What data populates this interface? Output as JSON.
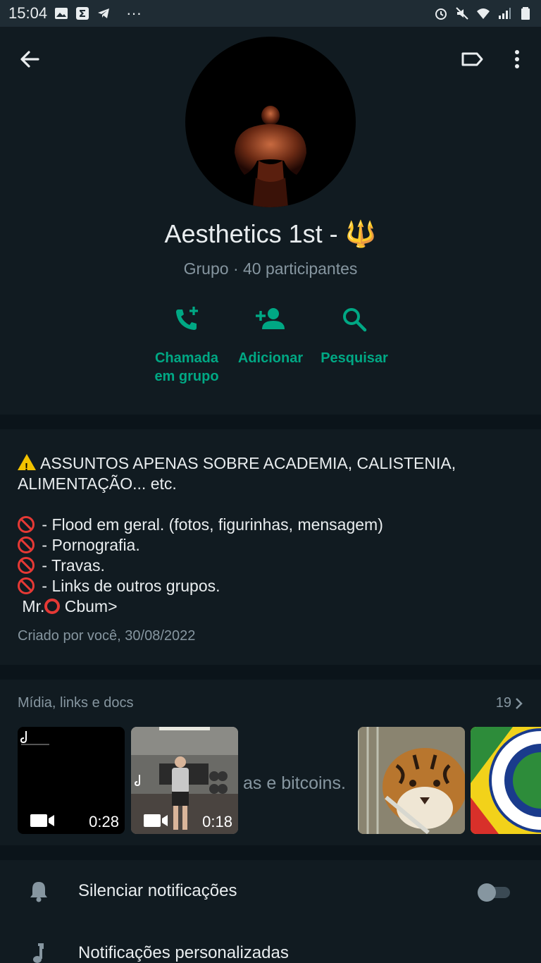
{
  "statusbar": {
    "time": "15:04",
    "more": "···"
  },
  "group": {
    "title": "Aesthetics 1st - 🔱",
    "subtitle": "Grupo · 40 participantes"
  },
  "actions": [
    {
      "label_line1": "Chamada",
      "label_line2": "em grupo",
      "icon": "add-call-icon"
    },
    {
      "label_line1": "Adicionar",
      "label_line2": "",
      "icon": "add-person-icon"
    },
    {
      "label_line1": "Pesquisar",
      "label_line2": "",
      "icon": "search-icon"
    }
  ],
  "description": {
    "line1": "ASSUNTOS APENAS SOBRE ACADEMIA, CALISTENIA,",
    "line2": "ALIMENTAÇÃO... etc.",
    "rules": [
      " - Flood em geral. (fotos, figurinhas, mensagem)",
      " - Pornografia.",
      " - Travas.",
      " - Links de outros grupos."
    ],
    "signature_pre": " Mr.",
    "signature_post": " Cbum>",
    "created": "Criado por você, 30/08/2022"
  },
  "media": {
    "header": "Mídia, links e docs",
    "count": "19",
    "items": [
      {
        "type": "video",
        "duration": "0:28"
      },
      {
        "type": "video",
        "duration": "0:18"
      },
      {
        "type": "image",
        "desc": "tiger"
      },
      {
        "type": "image",
        "desc": "seal"
      }
    ],
    "overlay_text": "as e bitcoins."
  },
  "settings": {
    "mute_label": "Silenciar notificações",
    "mute_on": false,
    "custom_label": "Notificações personalizadas"
  },
  "colors": {
    "accent": "#00a884",
    "background": "#0b141a",
    "surface": "#111b21"
  }
}
